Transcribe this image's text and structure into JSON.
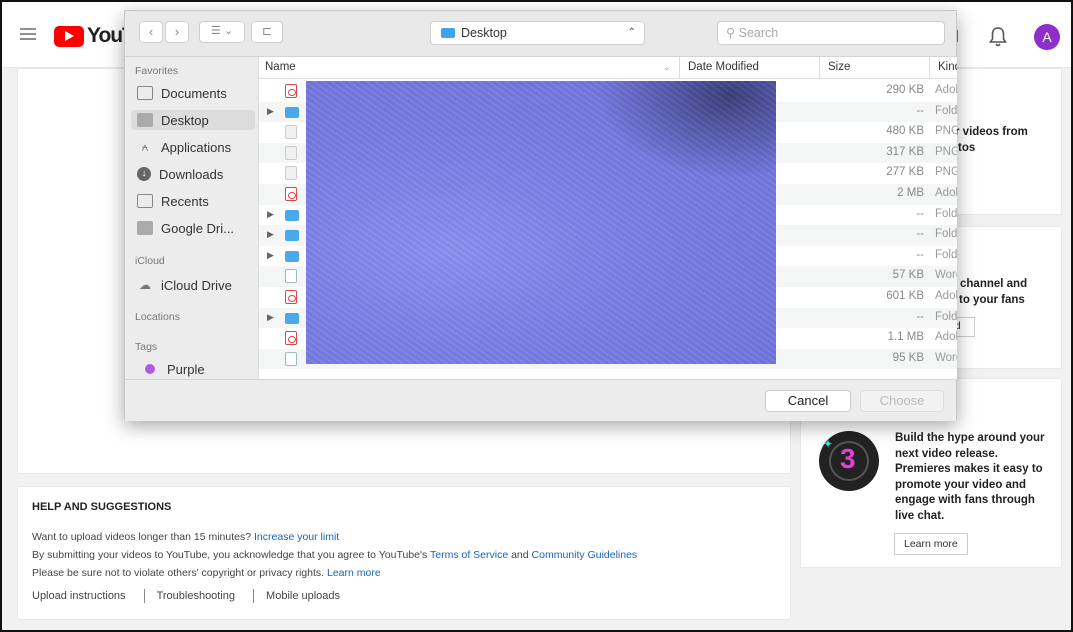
{
  "header": {
    "logo_text": "YouT",
    "avatar_letter": "A"
  },
  "dialog": {
    "location": "Desktop",
    "search_placeholder": "Search",
    "sidebar": {
      "favorites_heading": "Favorites",
      "favorites": [
        "Documents",
        "Desktop",
        "Applications",
        "Downloads",
        "Recents",
        "Google Dri..."
      ],
      "icloud_heading": "iCloud",
      "icloud": [
        "iCloud Drive"
      ],
      "locations_heading": "Locations",
      "tags_heading": "Tags",
      "tags": [
        "Purple"
      ]
    },
    "columns": {
      "name": "Name",
      "date_modified": "Date Modified",
      "size": "Size",
      "kind": "Kind"
    },
    "files": [
      {
        "icon": "pdf",
        "size": "290 KB",
        "kind": "Adobe"
      },
      {
        "icon": "folder",
        "size": "--",
        "kind": "Folder"
      },
      {
        "icon": "image",
        "size": "480 KB",
        "kind": "PNG"
      },
      {
        "icon": "image",
        "size": "317 KB",
        "kind": "PNG"
      },
      {
        "icon": "image",
        "size": "277 KB",
        "kind": "PNG"
      },
      {
        "icon": "pdf",
        "size": "2 MB",
        "kind": "Adobe"
      },
      {
        "icon": "folder",
        "size": "--",
        "kind": "Folder"
      },
      {
        "icon": "folder",
        "size": "--",
        "kind": "Folder"
      },
      {
        "icon": "folder",
        "size": "--",
        "kind": "Folder"
      },
      {
        "icon": "word",
        "size": "57 KB",
        "kind": "Word"
      },
      {
        "icon": "pdf",
        "size": "601 KB",
        "kind": "Adobe"
      },
      {
        "icon": "folder",
        "size": "--",
        "kind": "Folder"
      },
      {
        "icon": "pdf",
        "size": "1.1 MB",
        "kind": "Adobe"
      },
      {
        "icon": "word",
        "size": "95 KB",
        "kind": "Word"
      }
    ],
    "cancel_label": "Cancel",
    "choose_label": "Choose"
  },
  "right_panels": {
    "card1_text_1": "r videos from",
    "card1_text_2": "tos",
    "card2_text_1": "channel and",
    "card2_text_2": "to your fans",
    "card2_btn": "d",
    "premiere_number": "3",
    "premiere_text": "Build the hype around your next video release. Premieres makes it easy to promote your video and engage with fans through live chat.",
    "learn_more": "Learn more"
  },
  "help": {
    "title": "HELP AND SUGGESTIONS",
    "line1_text": "Want to upload videos longer than 15 minutes?",
    "line1_link": "Increase your limit",
    "line2_text": "By submitting your videos to YouTube, you acknowledge that you agree to YouTube's",
    "line2_link1": "Terms of Service",
    "line2_and": "and",
    "line2_link2": "Community Guidelines",
    "line3_text": "Please be sure not to violate others' copyright or privacy rights.",
    "line3_link": "Learn more",
    "links": [
      "Upload instructions",
      "Troubleshooting",
      "Mobile uploads"
    ]
  }
}
